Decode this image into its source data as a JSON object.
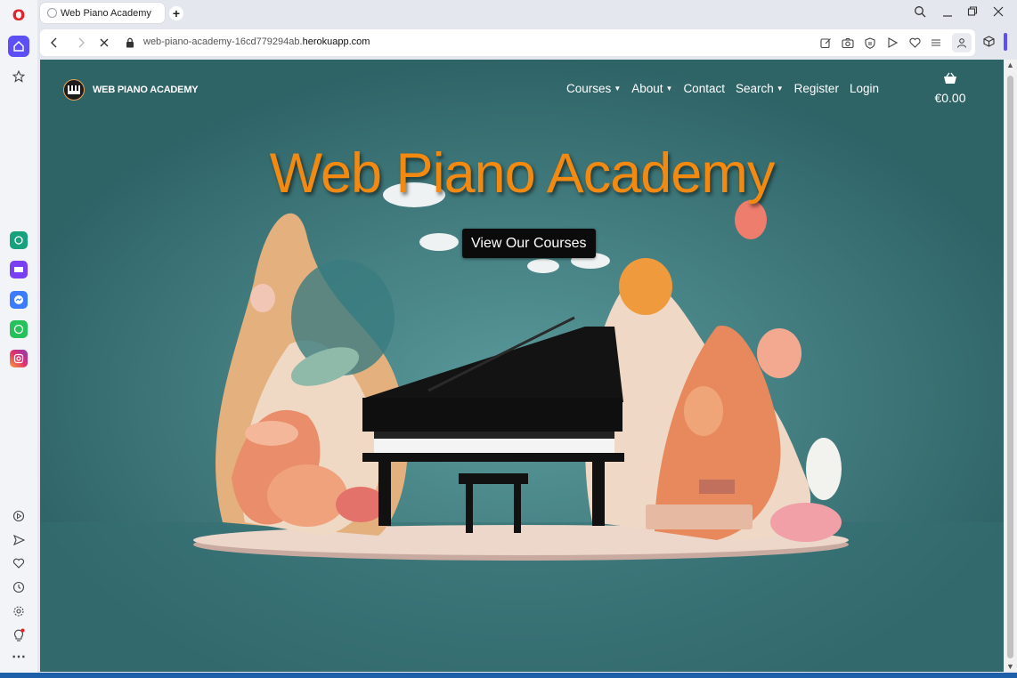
{
  "browser": {
    "tab": {
      "title": "Web Piano Academy"
    },
    "address": {
      "url_prefix": "web-piano-academy-16cd779294ab.",
      "url_domain": "herokuapp.com"
    }
  },
  "sidebar": {
    "icons": [
      "opera-logo",
      "home-icon",
      "bookmarks-icon",
      "chatgpt-icon",
      "chatsonic-icon",
      "messenger-icon",
      "whatsapp-icon",
      "instagram-icon",
      "player-icon",
      "flow-icon",
      "heart-icon",
      "history-icon",
      "settings-icon",
      "tips-icon",
      "more-icon"
    ]
  },
  "site": {
    "brand": "WEB PIANO ACADEMY",
    "nav": [
      {
        "label": "Courses",
        "dropdown": true
      },
      {
        "label": "About",
        "dropdown": true
      },
      {
        "label": "Contact",
        "dropdown": false
      },
      {
        "label": "Search",
        "dropdown": true
      },
      {
        "label": "Register",
        "dropdown": false
      },
      {
        "label": "Login",
        "dropdown": false
      }
    ],
    "cart_total": "€0.00",
    "hero_title": "Web Piano Academy",
    "cta_label": "View Our Courses"
  },
  "colors": {
    "accent": "#5b4ff5",
    "hero_title": "#f28a12",
    "background": "#3f7b80"
  }
}
